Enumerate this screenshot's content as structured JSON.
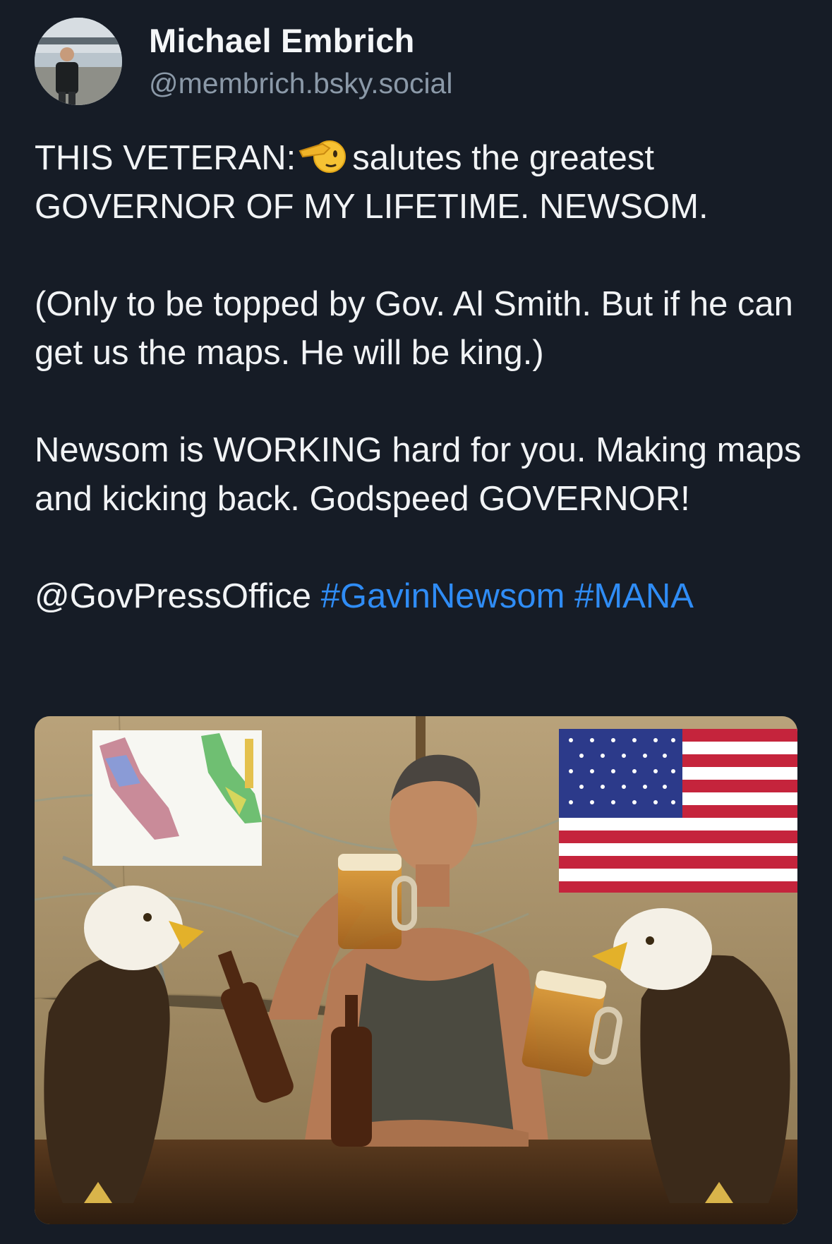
{
  "author": {
    "name": "Michael Embrich",
    "handle": "@membrich.bsky.social",
    "avatar_icon": "avatar-photo-icon"
  },
  "post": {
    "line1_before_emoji": "THIS VETERAN:",
    "emoji_icon": "saluting-face-icon",
    "line1_after_emoji": "salutes the greatest GOVERNOR OF MY LIFETIME. NEWSOM.",
    "paragraph2": "(Only to be topped by Gov. Al Smith. But if he can get us the maps. He will be king.)",
    "paragraph3": "Newsom is WORKING hard for you. Making maps and kicking back.  Godspeed GOVERNOR!",
    "mention": "@GovPressOffice",
    "hashtags": [
      "#GavinNewsom",
      "#MANA"
    ]
  },
  "media": {
    "image_icon": "attached-image-icon",
    "colors": {
      "hashtag": "#2f8cf5",
      "background": "#161c26",
      "handle": "#8b99a8"
    }
  }
}
